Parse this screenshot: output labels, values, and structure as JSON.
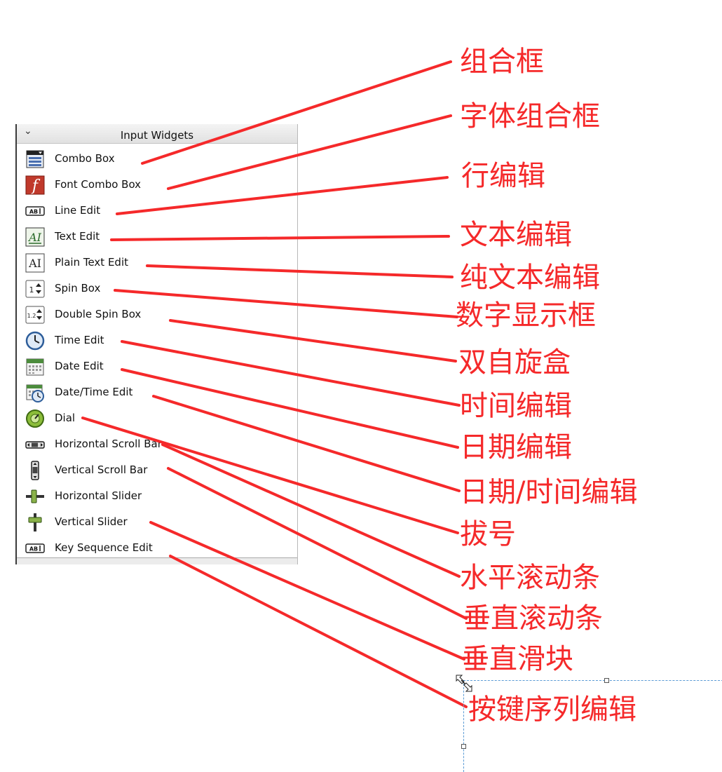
{
  "panel": {
    "title": "Input Widgets",
    "items": [
      {
        "label": "Combo Box",
        "icon": "combo-box-icon"
      },
      {
        "label": "Font Combo Box",
        "icon": "font-combo-box-icon"
      },
      {
        "label": "Line Edit",
        "icon": "line-edit-icon"
      },
      {
        "label": "Text Edit",
        "icon": "text-edit-icon"
      },
      {
        "label": "Plain Text Edit",
        "icon": "plain-text-edit-icon"
      },
      {
        "label": "Spin Box",
        "icon": "spin-box-icon"
      },
      {
        "label": "Double Spin Box",
        "icon": "double-spin-box-icon"
      },
      {
        "label": "Time Edit",
        "icon": "clock-icon"
      },
      {
        "label": "Date Edit",
        "icon": "calendar-icon"
      },
      {
        "label": "Date/Time Edit",
        "icon": "calendar-clock-icon"
      },
      {
        "label": "Dial",
        "icon": "dial-icon"
      },
      {
        "label": "Horizontal Scroll Bar",
        "icon": "horizontal-scroll-bar-icon"
      },
      {
        "label": "Vertical Scroll Bar",
        "icon": "vertical-scroll-bar-icon"
      },
      {
        "label": "Horizontal Slider",
        "icon": "horizontal-slider-icon"
      },
      {
        "label": "Vertical Slider",
        "icon": "vertical-slider-icon"
      },
      {
        "label": "Key Sequence Edit",
        "icon": "key-sequence-edit-icon"
      }
    ]
  },
  "annotations": [
    {
      "text": "组合框"
    },
    {
      "text": "字体组合框"
    },
    {
      "text": "行编辑"
    },
    {
      "text": "文本编辑"
    },
    {
      "text": "纯文本编辑"
    },
    {
      "text": "数字显示框"
    },
    {
      "text": "双自旋盒"
    },
    {
      "text": "时间编辑"
    },
    {
      "text": "日期编辑"
    },
    {
      "text": "日期/时间编辑"
    },
    {
      "text": "拔号"
    },
    {
      "text": "水平滚动条"
    },
    {
      "text": "垂直滚动条"
    },
    {
      "text": "垂直滑块"
    },
    {
      "text": "按键序列编辑"
    }
  ],
  "colors": {
    "annotation": "#f5292a",
    "selection": "#5b9bd5"
  }
}
